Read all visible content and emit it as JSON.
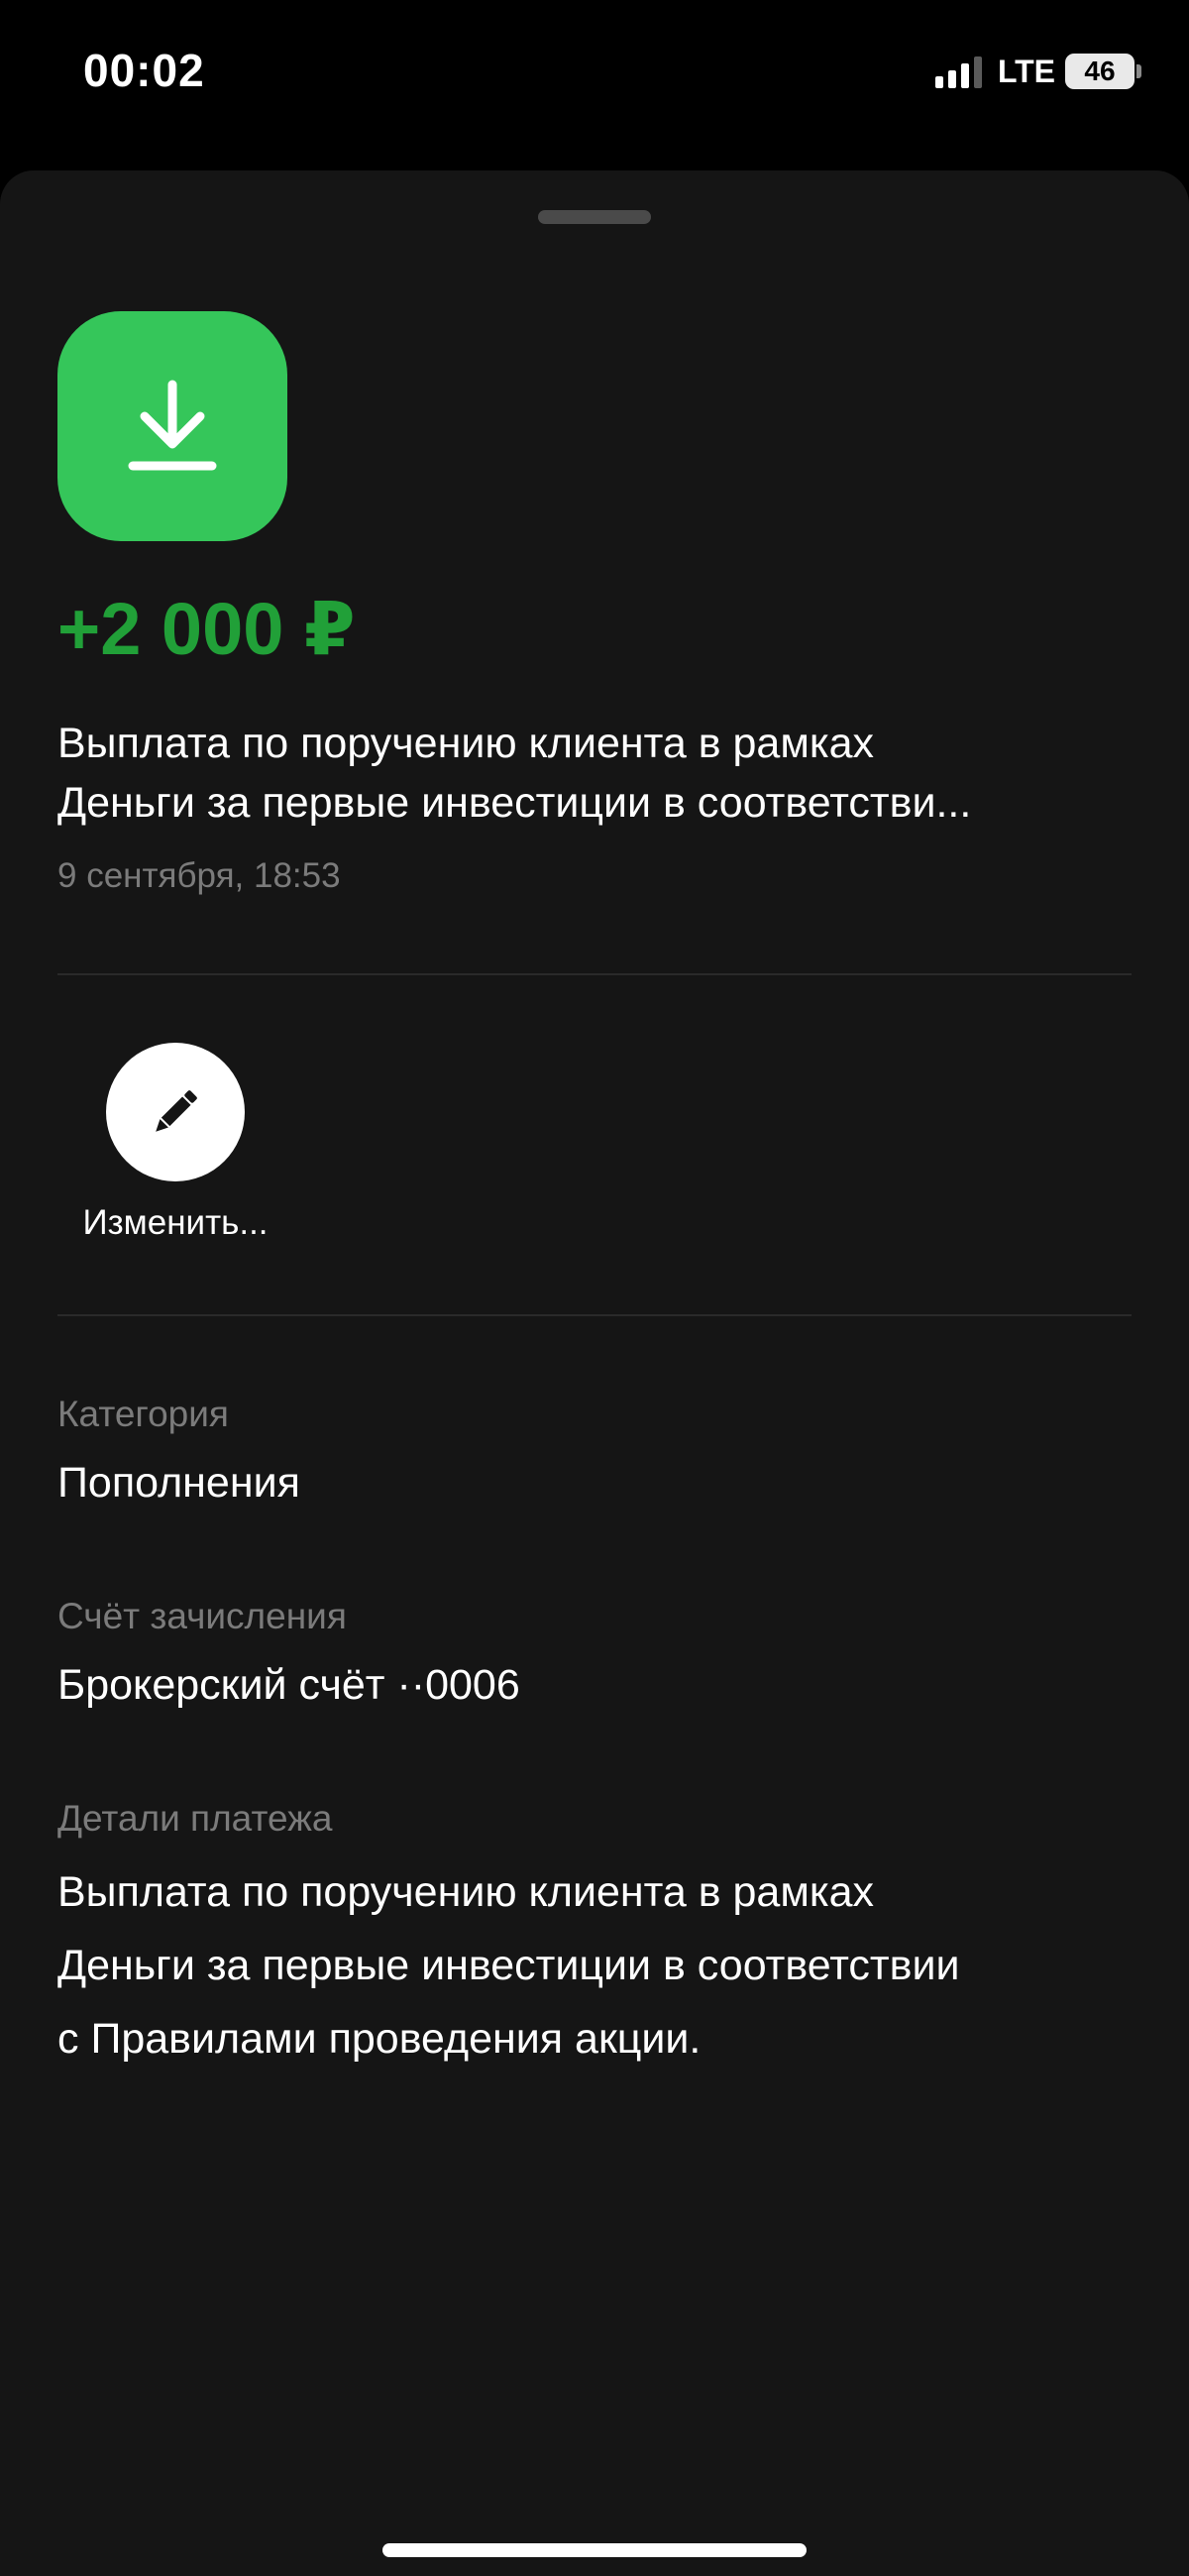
{
  "status_bar": {
    "time": "00:02",
    "network": "LTE",
    "battery": "46",
    "signal_bars_active": 3,
    "signal_bars_total": 4
  },
  "transaction": {
    "icon": "download-arrow-icon",
    "icon_color": "#35c65a",
    "amount": "+2 000 ₽",
    "amount_color": "#21a038",
    "description_lines": [
      "Выплата по поручению клиента в рамках",
      "Деньги за первые инвестиции в соответстви..."
    ],
    "date": "9 сентября, 18:53"
  },
  "actions": {
    "edit_label": "Изменить..."
  },
  "fields": {
    "category_label": "Категория",
    "category_value": "Пополнения",
    "account_label": "Счёт зачисления",
    "account_value": "Брокерский счёт ··0006",
    "details_label": "Детали платежа",
    "details_lines": [
      "Выплата по поручению клиента в рамках",
      "Деньги за первые инвестиции в соответствии",
      "с Правилами проведения акции."
    ]
  }
}
